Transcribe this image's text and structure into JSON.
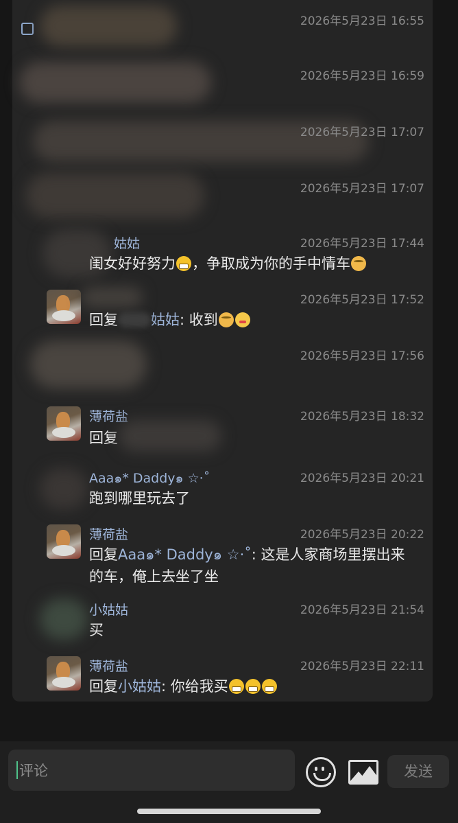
{
  "comments": [
    {
      "time": "2026年5月23日 16:55"
    },
    {
      "time": "2026年5月23日 16:59"
    },
    {
      "time": "2026年5月23日 17:07"
    },
    {
      "time": "2026年5月23日 17:07"
    },
    {
      "name": "姑姑",
      "time": "2026年5月23日 17:44",
      "text": "闺女好好努力",
      "text2": "，争取成为你的手中情车"
    },
    {
      "time": "2026年5月23日 17:52",
      "prefix": "回复",
      "mention": "姑姑",
      "text": ": 收到"
    },
    {
      "time": "2026年5月23日 17:56"
    },
    {
      "name": "薄荷盐",
      "time": "2026年5月23日 18:32",
      "prefix": "回复"
    },
    {
      "name": "Aaa๑* Daddy๑ ☆·˚",
      "time": "2026年5月23日 20:21",
      "text": "跑到哪里玩去了"
    },
    {
      "name": "薄荷盐",
      "time": "2026年5月23日 20:22",
      "prefix": "回复",
      "mention": "Aaa๑* Daddy๑ ☆·˚",
      "text": ": 这是人家商场里摆出来",
      "text_line2": "的车，俺上去坐了坐"
    },
    {
      "name": "小姑姑",
      "time": "2026年5月23日 21:54",
      "text": "买"
    },
    {
      "name": "薄荷盐",
      "time": "2026年5月23日 22:11",
      "prefix": "回复",
      "mention": "小姑姑",
      "text": ": 你给我买"
    }
  ],
  "composer": {
    "placeholder": "评论",
    "send_label": "发送",
    "emoji_button": "smile-icon",
    "image_button": "image-icon"
  },
  "colors": {
    "background": "#161616",
    "panel": "#252525",
    "name": "#9db4d8",
    "time": "#8a8a8a",
    "caret": "#4fc38a"
  }
}
